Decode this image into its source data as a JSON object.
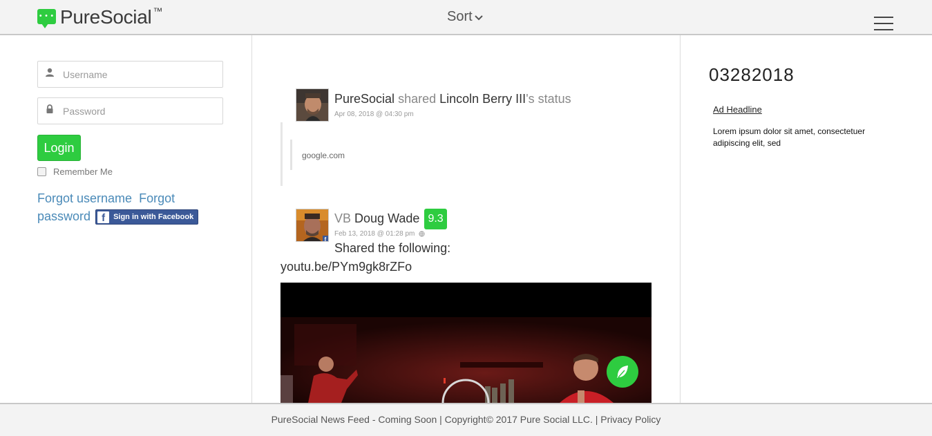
{
  "header": {
    "brand": "PureSocial",
    "brand_tm": "™",
    "sort_label": "Sort",
    "brand_color": "#2ecc40"
  },
  "login": {
    "username_placeholder": "Username",
    "password_placeholder": "Password",
    "login_label": "Login",
    "remember_label": "Remember Me",
    "forgot_username": "Forgot username",
    "forgot_password_1": "Forgot",
    "forgot_password_2": "password",
    "facebook_label": "Sign in with Facebook",
    "facebook_letter": "f"
  },
  "feed": {
    "post1": {
      "author": "PureSocial",
      "verb": "shared",
      "target": "Lincoln Berry III",
      "suffix": "'s status",
      "date": "Apr 08, 2018 @ 04:30 pm",
      "quote": "google.com"
    },
    "post2": {
      "prefix": "VB",
      "author": "Doug Wade",
      "score": "9.3",
      "date": "Feb 13, 2018 @ 01:28 pm",
      "shared_text": "Shared the following:",
      "link": "youtu.be/PYm9gk8rZFo"
    }
  },
  "sidebar": {
    "date_number": "03282018",
    "ad_headline": "Ad Headline",
    "ad_body": "Lorem ipsum dolor sit amet, consectetuer adipiscing elit, sed"
  },
  "footer": {
    "text": "PureSocial News Feed - Coming Soon | Copyright© 2017 Pure Social LLC. | ",
    "privacy": "Privacy Policy"
  }
}
